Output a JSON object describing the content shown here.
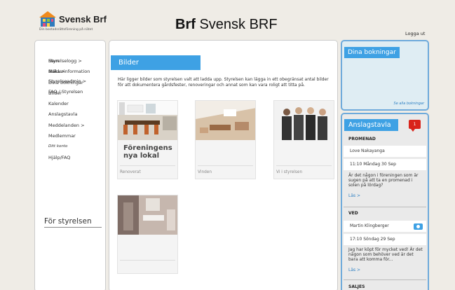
{
  "header": {
    "logo_name": "Svensk Brf",
    "logo_tagline": "Din bostadsrättsförening på nätet",
    "title_bold": "Brf",
    "title_rest": "Svensk BRF",
    "logout": "Logga ut"
  },
  "nav": {
    "items": [
      "Hem",
      "Boka >",
      "Dina bokningar",
      "Bilder",
      "Kalender",
      "Anslagstavla",
      "Meddelanden >",
      "Medlemmar",
      "Ditt konto",
      "Hjälp/FAQ"
    ]
  },
  "board_nav": {
    "heading": "För styrelsen",
    "items": [
      "Styrelselogg >",
      "Mäklarinformation",
      "Styrelseadmin >",
      "FAQ / Styrelsen"
    ]
  },
  "main": {
    "tab": "Bilder",
    "intro": "Här ligger bilder som styrelsen valt att ladda upp. Styrelsen kan lägga in ett obegränsat antal bilder för att dokumentera gårdsfester, renoveringar och annat som kan vara roligt att titta på.",
    "albums": [
      {
        "caption": "Renoverat",
        "overlay": "Föreningens nya lokal"
      },
      {
        "caption": "Vinden",
        "overlay": ""
      },
      {
        "caption": "Vi i styrelsen",
        "overlay": ""
      },
      {
        "caption": "",
        "overlay": ""
      }
    ]
  },
  "bookings": {
    "tab": "Dina bokningar",
    "link": "Se alla bokningar"
  },
  "noticeboard": {
    "tab": "Anslagstavla",
    "badge": "1",
    "posts": [
      {
        "title": "PROMENAD",
        "author": "Love Nakayanga",
        "time": "11:10 Måndag 30 Sep",
        "text": "Är det någon i föreningen som är sugen på att ta en promenad i solen på lördag?",
        "link": "Läs >"
      },
      {
        "title": "VED",
        "author": "Martin Klingberger",
        "time": "17:10 Söndag 29 Sep",
        "text": "Jag har köpt för mycket ved! Är det någon som behöver ved är det bara att komma för...",
        "link": "Läs >"
      },
      {
        "title": "SALJES",
        "author": "",
        "time": "",
        "text": "",
        "link": ""
      }
    ]
  },
  "colors": {
    "accent": "#3ea1e4",
    "badge": "#d9241b",
    "background": "#efece6"
  }
}
